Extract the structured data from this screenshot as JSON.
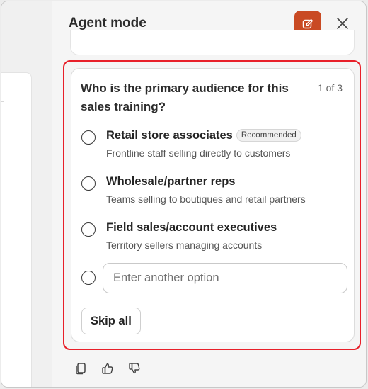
{
  "panel": {
    "title": "Agent mode",
    "new_chat_icon": "compose-icon",
    "close_icon": "close-icon",
    "accent_color": "#c94a23"
  },
  "question": {
    "text": "Who is the primary audience for this sales training?",
    "counter": "1 of 3",
    "options": [
      {
        "label": "Retail store associates",
        "badge": "Recommended",
        "description": "Frontline staff selling directly to customers"
      },
      {
        "label": "Wholesale/partner reps",
        "description": "Teams selling to boutiques and retail partners"
      },
      {
        "label": "Field sales/account executives",
        "description": "Territory sellers managing accounts"
      }
    ],
    "other_option": {
      "placeholder": "Enter another option",
      "value": ""
    },
    "skip_label": "Skip all"
  },
  "feedback": {
    "icons": [
      "copy-icon",
      "thumbs-up-icon",
      "thumbs-down-icon"
    ]
  },
  "highlight_color": "#e8202a"
}
